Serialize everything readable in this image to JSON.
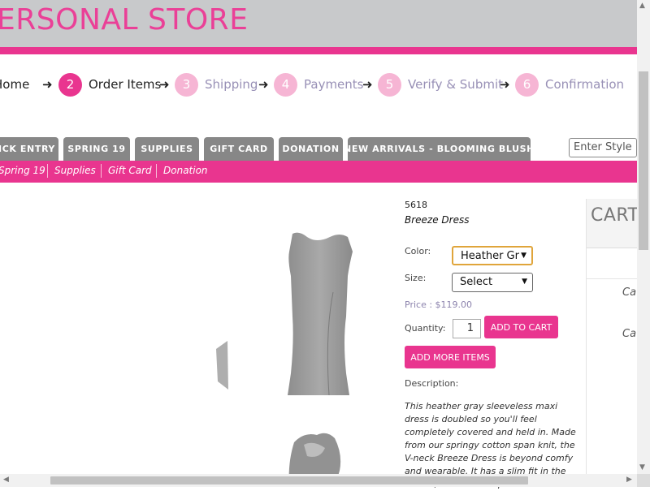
{
  "header": {
    "store_title": "ERSONAL STORE"
  },
  "steps": [
    {
      "number": "",
      "label": "Home"
    },
    {
      "number": "2",
      "label": "Order Items"
    },
    {
      "number": "3",
      "label": "Shipping"
    },
    {
      "number": "4",
      "label": "Payments"
    },
    {
      "number": "5",
      "label": "Verify & Submit"
    },
    {
      "number": "6",
      "label": "Confirmation"
    }
  ],
  "tabs": [
    "ICK ENTRY",
    "SPRING 19",
    "SUPPLIES",
    "GIFT CARD",
    "DONATION",
    "NEW ARRIVALS - BLOOMING BLUSH"
  ],
  "search": {
    "placeholder": "Enter Style I"
  },
  "subnav": [
    "Spring 19",
    "Supplies",
    "Gift Card",
    "Donation"
  ],
  "product": {
    "sku": "5618",
    "name": "Breeze Dress",
    "color_label": "Color:",
    "color_value": "Heather Gr",
    "size_label": "Size:",
    "size_value": "Select",
    "price": "Price : $119.00",
    "quantity_label": "Quantity:",
    "quantity_value": "1",
    "add_to_cart": "ADD TO CART",
    "add_more": "ADD MORE ITEMS",
    "description_label": "Description:",
    "description": "This heather gray sleeveless maxi dress is doubled so you'll feel completely covered and held in. Made from our springy cotton span knit, the V-neck Breeze Dress is beyond comfy and wearable. It has a slim fit in the bodice, an A-line shape at the"
  },
  "cart": {
    "title": "CART",
    "item1": "Ca",
    "item2": "Ca"
  },
  "colors": {
    "accent": "#e9358f",
    "accent_light": "#f6b5d4",
    "header_bg": "#c8c9cb",
    "tab_bg": "#878787"
  },
  "icons": {
    "step_arrow": "arrow-right-icon",
    "caret": "caret-down-icon"
  }
}
